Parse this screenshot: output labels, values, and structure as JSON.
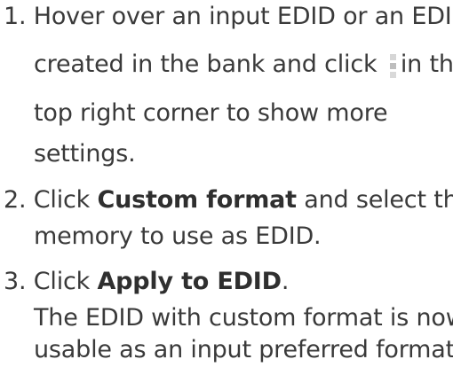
{
  "steps": [
    {
      "number": "1.",
      "line1": "Hover over an input EDID or an EDID",
      "line2_before": "created in the bank and click",
      "line2_after": "in the",
      "line3": "top right corner to show more",
      "line4": "settings.",
      "icon": "more-options-icon"
    },
    {
      "number": "2.",
      "line1_before": "Click ",
      "line1_bold": "Custom format",
      "line1_after": " and select the",
      "line2": "memory to use as EDID."
    },
    {
      "number": "3.",
      "line1_before": "Click ",
      "line1_bold": "Apply to EDID",
      "line1_after": ".",
      "result_line1": "The EDID with custom format is now",
      "result_line2": "usable as an input preferred format."
    }
  ]
}
